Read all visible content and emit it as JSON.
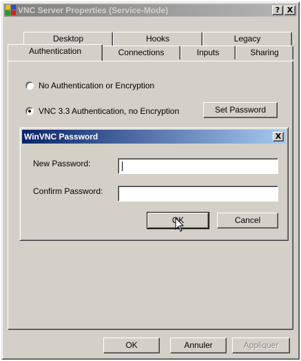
{
  "window": {
    "title": "VNC Server Properties (Service-Mode)",
    "help_button": "?",
    "close_button": "X"
  },
  "tabs": {
    "row_back": [
      "Desktop",
      "Hooks",
      "Legacy"
    ],
    "row_front": [
      "Authentication",
      "Connections",
      "Inputs",
      "Sharing"
    ],
    "active": "Authentication"
  },
  "auth": {
    "options": [
      {
        "label": "No Authentication or Encryption",
        "checked": false
      },
      {
        "label": "VNC 3.3 Authentication, no Encryption",
        "checked": true
      }
    ],
    "set_password_button": "Set Password"
  },
  "dialog": {
    "title": "WinVNC Password",
    "close_button": "X",
    "new_password_label": "New Password:",
    "new_password_value": "",
    "confirm_password_label": "Confirm Password:",
    "confirm_password_value": "",
    "ok_button": "OK",
    "cancel_button": "Cancel"
  },
  "footer": {
    "ok_button": "OK",
    "cancel_button": "Annuler",
    "apply_button": "Appliquer"
  },
  "colors": {
    "dialog_title_start": "#0a246a",
    "dialog_title_end": "#a6caf0",
    "face": "#d4d0c8"
  }
}
